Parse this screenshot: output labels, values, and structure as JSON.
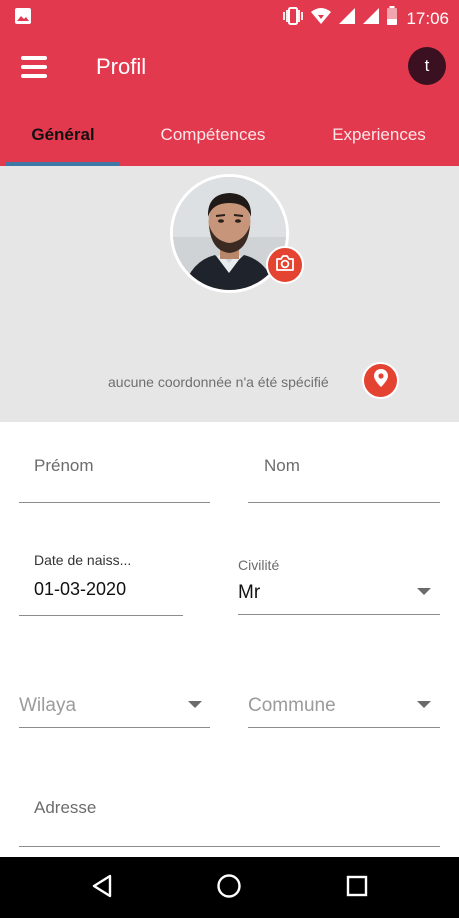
{
  "status_bar": {
    "time": "17:06",
    "icons": [
      "image-icon",
      "vibrate-icon",
      "wifi-icon",
      "signal-icon",
      "signal-icon",
      "battery-icon"
    ]
  },
  "app_bar": {
    "title": "Profil",
    "avatar_letter": "t",
    "menu_icon": "menu-icon"
  },
  "tabs": [
    {
      "label": "Général",
      "active": true
    },
    {
      "label": "Compétences",
      "active": false
    },
    {
      "label": "Experiences",
      "active": false
    }
  ],
  "header": {
    "coords_text": "aucune coordonnée n'a été spécifié",
    "camera_icon": "camera-icon",
    "location_icon": "location-pin-icon"
  },
  "form": {
    "prenom": {
      "placeholder": "Prénom",
      "value": ""
    },
    "nom": {
      "placeholder": "Nom",
      "value": ""
    },
    "date_naissance": {
      "label": "Date de naiss...",
      "value": "01-03-2020"
    },
    "civilite": {
      "label": "Civilité",
      "value": "Mr"
    },
    "wilaya": {
      "placeholder": "Wilaya"
    },
    "commune": {
      "placeholder": "Commune"
    },
    "adresse": {
      "placeholder": "Adresse",
      "value": ""
    }
  },
  "colors": {
    "primary": "#e3394e",
    "accent": "#e44332",
    "tab_indicator": "#3f77a6",
    "header_bg": "#e6e6e6"
  }
}
